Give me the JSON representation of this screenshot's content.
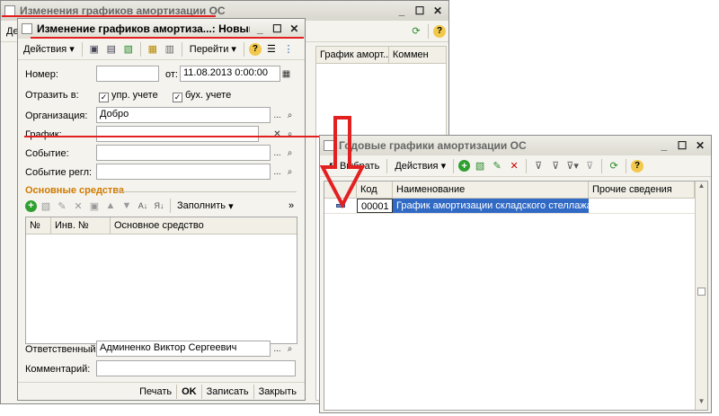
{
  "bg_window": {
    "title": "Изменения графиков амортизации ОС",
    "menu_stub": "Де",
    "col_schedule": "График аморт...",
    "col_comment": "Коммен"
  },
  "doc_window": {
    "title": "Изменение графиков амортиза...: Новый *",
    "toolbar": {
      "actions": "Действия",
      "goto": "Перейти"
    },
    "number_label": "Номер:",
    "number_value": "",
    "date_prefix": "от:",
    "date_value": "11.08.2013  0:00:00",
    "reflect_label": "Отразить в:",
    "check_mgmt": "упр. учете",
    "check_acc": "бух. учете",
    "org_label": "Организация:",
    "org_value": "Добро",
    "schedule_label": "График:",
    "schedule_value": "",
    "event_label": "Событие:",
    "event_value": "",
    "event_reg_label": "Событие регл:",
    "event_reg_value": "",
    "section_title": "Основные средства",
    "fill_label": "Заполнить",
    "grid_cols": [
      "№",
      "Инв. №",
      "Основное средство"
    ],
    "responsible_label": "Ответственный:",
    "responsible_value": "Админенко Виктор Сергеевич",
    "comment_label": "Комментарий:",
    "comment_value": "",
    "footer": {
      "print": "Печать",
      "ok": "OK",
      "save": "Записать",
      "close": "Закрыть"
    },
    "button_dots": "..."
  },
  "select_window": {
    "title": "Годовые графики амортизации ОС",
    "toolbar": {
      "select": "Выбрать",
      "actions": "Действия"
    },
    "cols": [
      "Код",
      "Наименование",
      "Прочие сведения"
    ],
    "rows": [
      {
        "code": "00001",
        "name": "График амортизации складского стеллажа",
        "extra": ""
      }
    ]
  },
  "colors": {
    "accent_red": "#e32020",
    "selection": "#316ac5",
    "section_orange": "#d07a00",
    "window_bg": "#f4f3ee"
  }
}
